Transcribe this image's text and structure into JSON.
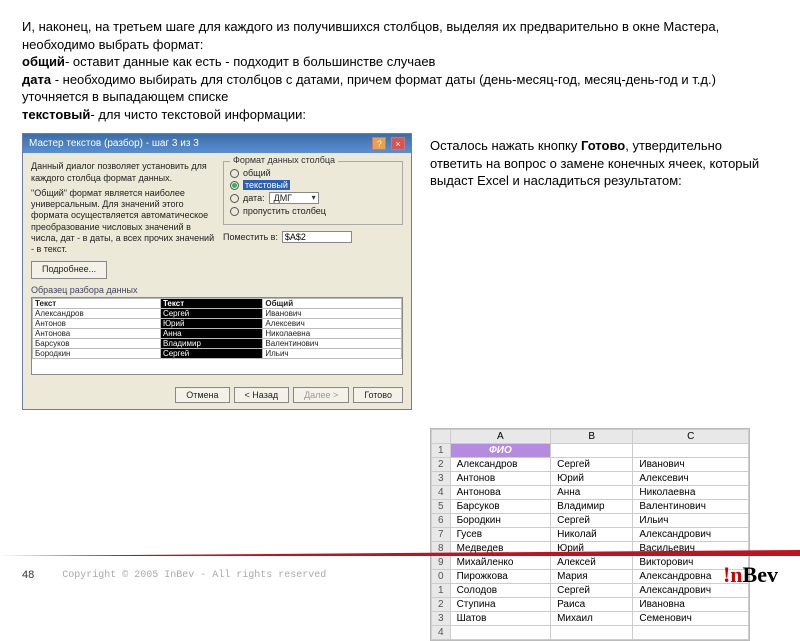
{
  "intro": {
    "p1a": "И, наконец, на третьем шаге для каждого из получившихся столбцов, выделяя их предварительно в окне Мастера, необходимо выбрать формат:",
    "b1": "общий",
    "p2": "- оставит данные как есть - подходит в большинстве случаев",
    "b2": "дата",
    "p3": " - необходимо выбирать для столбцов с датами, причем формат даты (день-месяц-год, месяц-день-год и т.д.) уточняется в выпадающем списке",
    "b3": "текстовый",
    "p4": "- для чисто текстовой информации:"
  },
  "wizard": {
    "title": "Мастер текстов (разбор) - шаг 3 из 3",
    "desc": "Данный диалог позволяет установить для каждого столбца формат данных.",
    "desc2": "\"Общий\" формат является наиболее универсальным. Для значений этого формата осуществляется автоматическое преобразование числовых значений в числа, дат - в даты, а всех прочих значений - в текст.",
    "more_btn": "Подробнее...",
    "fieldset": "Формат данных столбца",
    "opt_general": "общий",
    "opt_text": "текстовый",
    "opt_date": "дата:",
    "date_fmt": "ДМГ",
    "opt_skip": "пропустить столбец",
    "place_label": "Поместить в:",
    "place_val": "$A$2",
    "preview_label": "Образец разбора данных",
    "headers": [
      "Текст",
      "Текст",
      "Общий"
    ],
    "rows": [
      [
        "Александров",
        "Сергей",
        "Иванович"
      ],
      [
        "Антонов",
        "Юрий",
        "Алексевич"
      ],
      [
        "Антонова",
        "Анна",
        "Николаевна"
      ],
      [
        "Барсуков",
        "Владимир",
        "Валентинович"
      ],
      [
        "Бородкин",
        "Сергей",
        "Ильич"
      ]
    ],
    "btn_cancel": "Отмена",
    "btn_back": "< Назад",
    "btn_next": "Далее >",
    "btn_finish": "Готово"
  },
  "right": {
    "p1": "Осталось нажать кнопку ",
    "b": "Готово",
    "p2": ", утвердительно ответить на вопрос о замене конечных ячеек, который выдаст Excel и насладиться результатом:"
  },
  "sheet": {
    "cols": [
      "",
      "A",
      "B",
      "C"
    ],
    "fio": "ФИО",
    "rows": [
      [
        "2",
        "Александров",
        "Сергей",
        "Иванович"
      ],
      [
        "3",
        "Антонов",
        "Юрий",
        "Алексевич"
      ],
      [
        "4",
        "Антонова",
        "Анна",
        "Николаевна"
      ],
      [
        "5",
        "Барсуков",
        "Владимир",
        "Валентинович"
      ],
      [
        "6",
        "Бородкин",
        "Сергей",
        "Ильич"
      ],
      [
        "7",
        "Гусев",
        "Николай",
        "Александрович"
      ],
      [
        "8",
        "Медведев",
        "Юрий",
        "Васильевич"
      ],
      [
        "9",
        "Михайленко",
        "Алексей",
        "Викторович"
      ],
      [
        "0",
        "Пирожкова",
        "Мария",
        "Александровна"
      ],
      [
        "1",
        "Солодов",
        "Сергей",
        "Александрович"
      ],
      [
        "2",
        "Ступина",
        "Раиса",
        "Ивановна"
      ],
      [
        "3",
        "Шатов",
        "Михаил",
        "Семенович"
      ]
    ]
  },
  "footer": {
    "page": "48",
    "copyright": "Copyright © 2005 InBev - All rights reserved",
    "logo_ex": "!",
    "logo_in": "n",
    "logo_bev": "Bev",
    "logo_i": "I"
  }
}
